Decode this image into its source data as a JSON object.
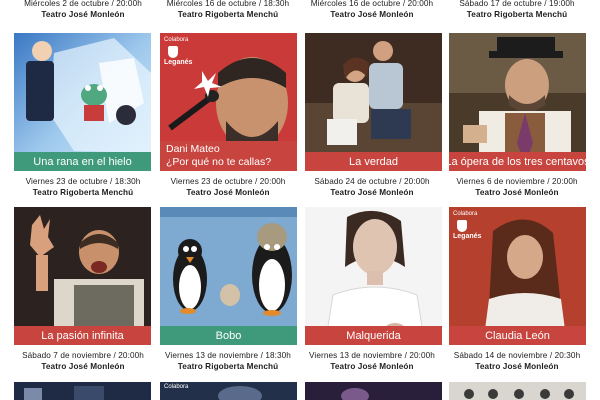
{
  "top_row": [
    {
      "date": "Miércoles 2 de octubre / 20:00h",
      "venue": "Teatro José Monleón"
    },
    {
      "date": "Miércoles 16 de octubre / 18:30h",
      "venue": "Teatro Rigoberta Menchú"
    },
    {
      "date": "Miércoles 16 de octubre / 20:00h",
      "venue": "Teatro José Monleón"
    },
    {
      "date": "Sábado 17 de octubre / 19:00h",
      "venue": "Teatro Rigoberta Menchú"
    }
  ],
  "row1": [
    {
      "title": "Una rana en el hielo",
      "banner_color": "#3e9a7b"
    },
    {
      "title_line1": "Dani Mateo",
      "title_line2": "¿Por qué no te callas?",
      "banner_color": "#c8453f",
      "sponsor": {
        "label": "Colabora",
        "city": "Leganés"
      }
    },
    {
      "title": "La verdad",
      "banner_color": "#c8453f"
    },
    {
      "title": "La ópera de los tres centavos",
      "banner_color": "#c8453f"
    }
  ],
  "row1_captions": [
    {
      "date": "Viernes 23 de octubre / 18:30h",
      "venue": "Teatro Rigoberta Menchú"
    },
    {
      "date": "Viernes 23 de octubre / 20:00h",
      "venue": "Teatro José Monleón"
    },
    {
      "date": "Sábado 24 de octubre / 20:00h",
      "venue": "Teatro José Monleón"
    },
    {
      "date": "Viernes 6 de noviembre / 20:00h",
      "venue": "Teatro José Monleón"
    }
  ],
  "row2": [
    {
      "title": "La pasión infinita",
      "banner_color": "#c8453f"
    },
    {
      "title": "Bobo",
      "banner_color": "#3e9a7b"
    },
    {
      "title": "Malquerida",
      "banner_color": "#c8453f"
    },
    {
      "title": "Claudia León",
      "banner_color": "#c8453f",
      "sponsor": {
        "label": "Colabora",
        "city": "Leganés"
      }
    }
  ],
  "row2_captions": [
    {
      "date": "Sábado 7 de noviembre / 20:00h",
      "venue": "Teatro José Monleón"
    },
    {
      "date": "Viernes 13 de noviembre / 18:30h",
      "venue": "Teatro Rigoberta Menchú"
    },
    {
      "date": "Viernes 13 de noviembre / 20:00h",
      "venue": "Teatro José Monleón"
    },
    {
      "date": "Sábado 14 de noviembre / 20:30h",
      "venue": "Teatro José Monleón"
    }
  ],
  "row3": [
    {
      "sponsor": null
    },
    {
      "sponsor": {
        "label": "Colabora"
      }
    },
    {
      "sponsor": null
    },
    {
      "sponsor": null
    }
  ]
}
